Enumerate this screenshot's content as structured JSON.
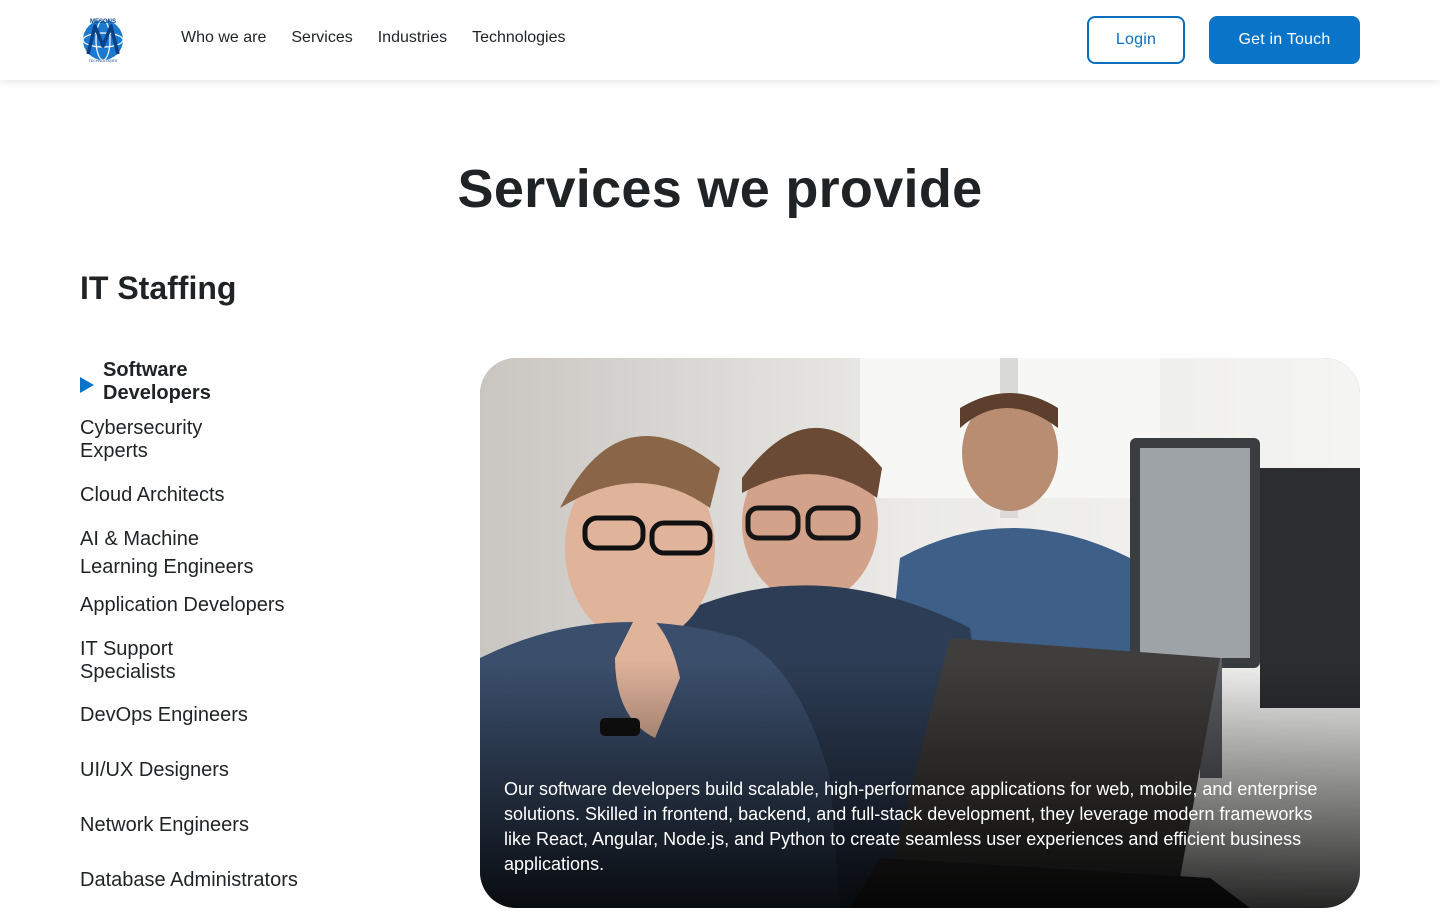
{
  "header": {
    "logo_top_text": "MESONS",
    "logo_bottom_text": "TECHNOLOGIES",
    "nav": [
      "Who we are",
      "Services",
      "Industries",
      "Technologies"
    ],
    "login_label": "Login",
    "cta_label": "Get in Touch",
    "brand_color": "#0a74c9"
  },
  "main": {
    "title": "Services we provide",
    "section_title": "IT Staffing",
    "items": [
      {
        "label": "Software\nDevelopers",
        "active": true
      },
      {
        "label": "Cybersecurity\nExperts"
      },
      {
        "label": "Cloud Architects"
      },
      {
        "label": "AI & Machine\nLearning Engineers"
      },
      {
        "label": "Application Developers"
      },
      {
        "label": "IT Support\nSpecialists"
      },
      {
        "label": "DevOps Engineers"
      },
      {
        "label": "UI/UX Designers"
      },
      {
        "label": "Network Engineers"
      },
      {
        "label": "Database Administrators"
      }
    ],
    "card": {
      "image": "developers-working-at-computers-photo",
      "description": "Our software developers build scalable, high-performance applications for web, mobile, and enterprise solutions. Skilled in frontend, backend, and full-stack development, they leverage modern frameworks like React, Angular, Node.js, and Python to create seamless user experiences and efficient business applications."
    }
  }
}
